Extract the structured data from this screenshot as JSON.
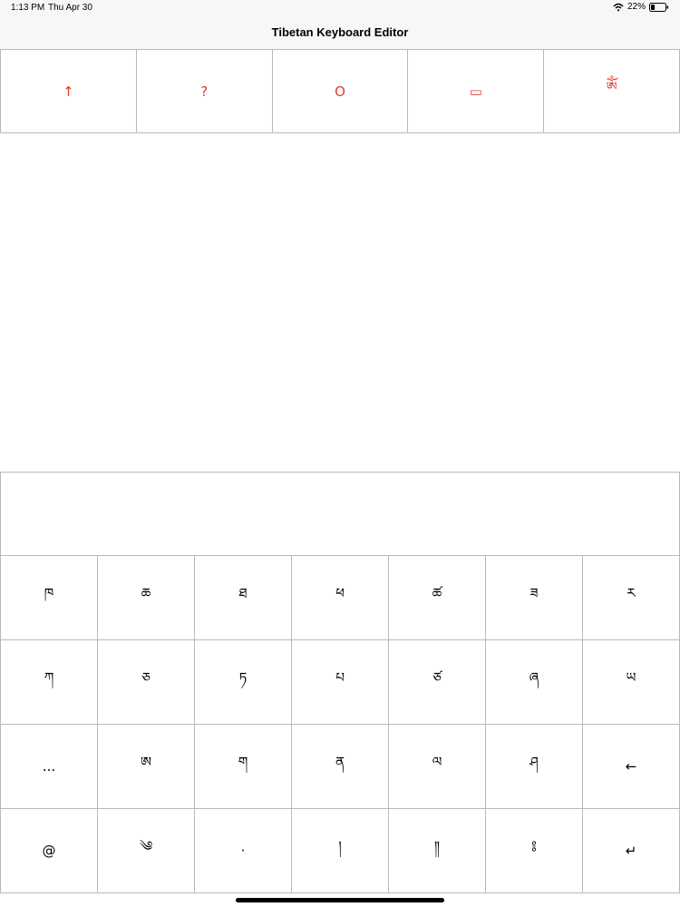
{
  "status_bar": {
    "time": "1:13 PM",
    "date": "Thu Apr 30",
    "battery": "22%",
    "wifi_icon": "wifi-icon",
    "battery_icon": "battery-icon"
  },
  "nav": {
    "title": "Tibetan Keyboard Editor"
  },
  "top_row": {
    "accent_color": "#e23b30",
    "keys": [
      "↑",
      "?",
      "O",
      "▭",
      "ༀ"
    ]
  },
  "compose": {
    "value": ""
  },
  "keyboard": {
    "rows": [
      [
        "ཁ",
        "ཆ",
        "ཐ",
        "ཕ",
        "ཚ",
        "ཟ",
        "ར"
      ],
      [
        "ཀ",
        "ཅ",
        "ཏ",
        "པ",
        "ཙ",
        "ཞ",
        "ཡ"
      ],
      [
        "...",
        "ཨ",
        "ག",
        "ན",
        "ལ",
        "ཤ",
        "←"
      ],
      [
        "@",
        "༄",
        "·",
        "།",
        "༎",
        "༔",
        "↵"
      ]
    ]
  }
}
